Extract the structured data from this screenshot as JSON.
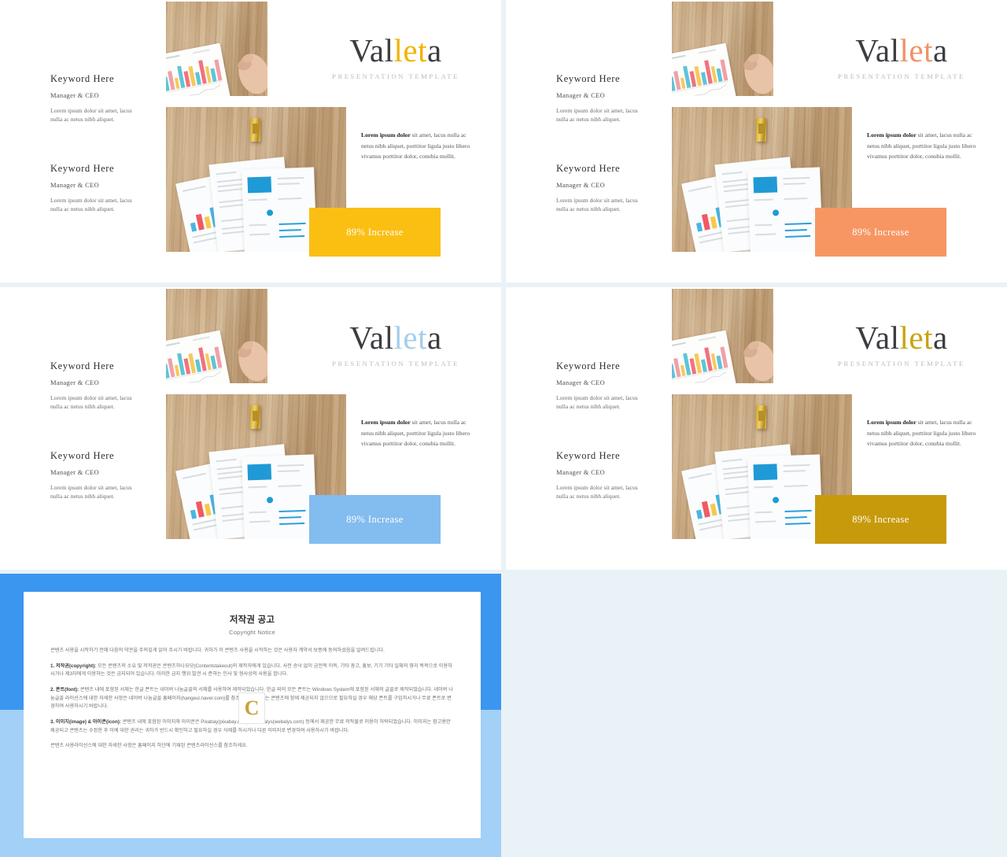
{
  "meta": {
    "canvas_bg": "#e9f2f6"
  },
  "slides": [
    {
      "id": "slide-1",
      "accent": "#f0b400",
      "badge_bg": "#fbbf14",
      "title_prefix": "Val",
      "title_highlight": "let",
      "title_suffix": "a",
      "subtitle": "PRESENTATION TEMPLATE",
      "keywords": [
        {
          "title": "Keyword Here",
          "role": "Manager & CEO",
          "body": "Lorem ipsum dolor sit amet, lacus nulla ac netus nibh aliquet."
        },
        {
          "title": "Keyword Here",
          "role": "Manager & CEO",
          "body": "Lorem ipsum dolor sit amet, lacus nulla ac netus nibh aliquet."
        }
      ],
      "paragraph_lead": "Lorem ipsum dolor",
      "paragraph_rest": " sit amet, lacus nulla ac netus nibh aliquet, porttitor ligula justo libero vivamus porttitor dolor, conubia mollit.",
      "badge_label": "89% Increase"
    },
    {
      "id": "slide-2",
      "accent": "#ef9266",
      "badge_bg": "#f79663",
      "title_prefix": "Val",
      "title_highlight": "let",
      "title_suffix": "a",
      "subtitle": "PRESENTATION TEMPLATE",
      "keywords": [
        {
          "title": "Keyword Here",
          "role": "Manager & CEO",
          "body": "Lorem ipsum dolor sit amet, lacus nulla ac netus nibh aliquet."
        },
        {
          "title": "Keyword Here",
          "role": "Manager & CEO",
          "body": "Lorem ipsum dolor sit amet, lacus nulla ac netus nibh aliquet."
        }
      ],
      "paragraph_lead": "Lorem ipsum dolor",
      "paragraph_rest": " sit amet, lacus nulla ac netus nibh aliquet, porttitor ligula justo libero vivamus porttitor dolor, conubia mollit.",
      "badge_label": "89% Increase"
    },
    {
      "id": "slide-3",
      "accent": "#a6cdeb",
      "badge_bg": "#83bcef",
      "title_prefix": "Val",
      "title_highlight": "let",
      "title_suffix": "a",
      "subtitle": "PRESENTATION TEMPLATE",
      "keywords": [
        {
          "title": "Keyword Here",
          "role": "Manager & CEO",
          "body": "Lorem ipsum dolor sit amet, lacus nulla ac netus nibh aliquet."
        },
        {
          "title": "Keyword Here",
          "role": "Manager & CEO",
          "body": "Lorem ipsum dolor sit amet, lacus nulla ac netus nibh aliquet."
        }
      ],
      "paragraph_lead": "Lorem ipsum dolor",
      "paragraph_rest": " sit amet, lacus nulla ac netus nibh aliquet, porttitor ligula justo libero vivamus porttitor dolor, conubia mollit.",
      "badge_label": "89% Increase"
    },
    {
      "id": "slide-4",
      "accent": "#c9a30e",
      "badge_bg": "#c79a0c",
      "title_prefix": "Val",
      "title_highlight": "let",
      "title_suffix": "a",
      "subtitle": "PRESENTATION TEMPLATE",
      "keywords": [
        {
          "title": "Keyword Here",
          "role": "Manager & CEO",
          "body": "Lorem ipsum dolor sit amet, lacus nulla ac netus nibh aliquet."
        },
        {
          "title": "Keyword Here",
          "role": "Manager & CEO",
          "body": "Lorem ipsum dolor sit amet, lacus nulla ac netus nibh aliquet."
        }
      ],
      "paragraph_lead": "Lorem ipsum dolor",
      "paragraph_rest": " sit amet, lacus nulla ac netus nibh aliquet, porttitor ligula justo libero vivamus porttitor dolor, conubia mollit.",
      "badge_label": "89% Increase"
    }
  ],
  "copyright": {
    "title_ko": "저작권 공고",
    "title_en": "Copyright Notice",
    "intro": "콘텐츠 사용을 시작하기 전에 다음의 약관을 주의깊게 읽어 주시기 바랍니다. 귀하가 이 콘텐츠 사용을 시작하는 것은 사용자 계약서 보증에 동의하셨음을 알려드립니다.",
    "items": [
      {
        "label": "1. 저작권(copyright):",
        "text": " 모든 콘텐츠의 소유 및 저작권은 콘텐츠하나요닷(Contentstakeout)의 제작자에게 있습니다. 사전 승낙 없이 금전적 이득, 기타 광고, 홍보, 기기 기타 일체의 영리 목적으로 이용하시거나 제3자에게 이용하는 것은 금지되어 있습니다. 이러한 금지 행위 발견 시 준하는 민사 및 형사상의 사용을 합니다."
      },
      {
        "label": "2. 폰트(font):",
        "text": " 콘텐츠 내에 포함된 서체는 한글 폰트는 네이버 나눔글꼴의 서체를 사용하여 제작되었습니다. 한글 외의 모든 폰트는 Windows System에 포함된 서체의 글꼴로 제작되었습니다. 네이버 나눔글꼴 라이선스에 대한 자세한 사항은 네이버 나눔글꼴 홈페이지(hangeul.naver.com)를 참조하세요. 폰트는 콘텐츠에 함께 제공되지 않으므로 필요하실 경우 해당 폰트를 구입하시거나 무료 폰트로 변경하여 사용하시기 바랍니다."
      },
      {
        "label": "3. 이미지(image) & 아이콘(icon):",
        "text": " 콘텐츠 내에 포함된 이미지와 아이콘은 Pixabay(pixabay.com)와 Webalys(webalys.com) 등에서 제공한 무료 저작물로 이용이 허락되었습니다. 이미지는 참고용만 제공되고 콘텐츠는 수정한 후 이에 대한 권리는 귀하가 반드시 확인하고 필요하실 경우 삭제를 하시거나 다른 이미지로 변경하여 사용하시기 바랍니다."
      }
    ],
    "outro": "콘텐츠 사용라이선스에 대한 자세한 사항은 홈페이지 하단에 기재된 콘텐츠라이선스를 참조하세요.",
    "watermark": "C"
  }
}
